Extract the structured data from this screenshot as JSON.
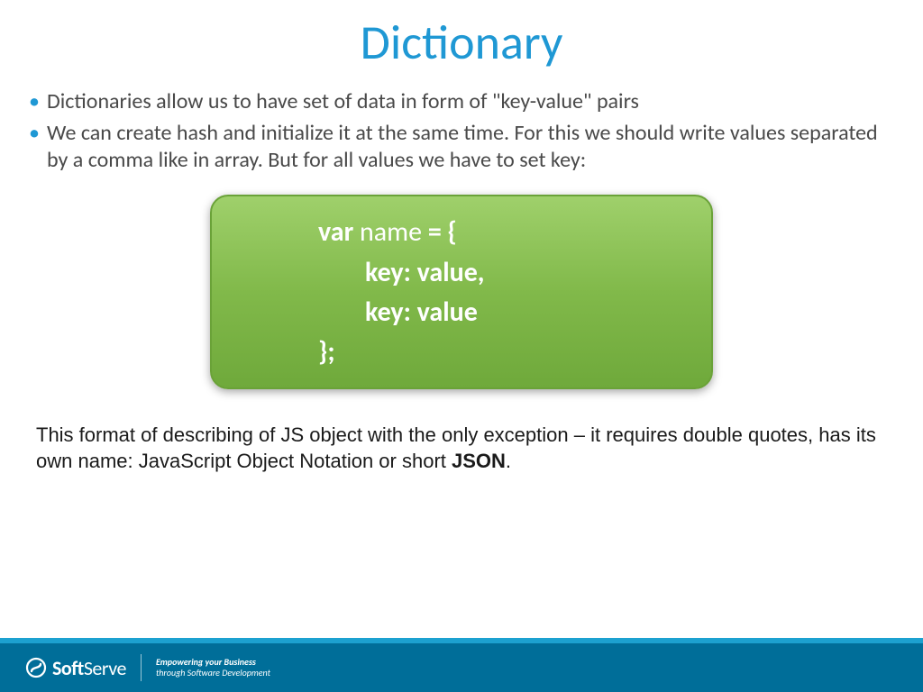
{
  "title": "Dictionary",
  "bullets": [
    "Dictionaries allow us to have set of data in form of \"key-value\" pairs",
    "We can create hash and initialize it at the same time. For this we should write values separated by a comma like in array. But for all values we have to set key:"
  ],
  "code": {
    "l1a": "var ",
    "l1b": "name",
    "l1c": " = {",
    "l2": "key: value,",
    "l3": "key: value",
    "l4": "};"
  },
  "note": {
    "p1": "This format of describing of JS object with the only exception – it requires double quotes, has its own name: JavaScript Object Notation or short ",
    "bold": "JSON",
    "tail": "."
  },
  "footer": {
    "brand_bold": "Soft",
    "brand_rest": "Serve",
    "tagline1": "Empowering your Business",
    "tagline2": "through Software Development"
  }
}
